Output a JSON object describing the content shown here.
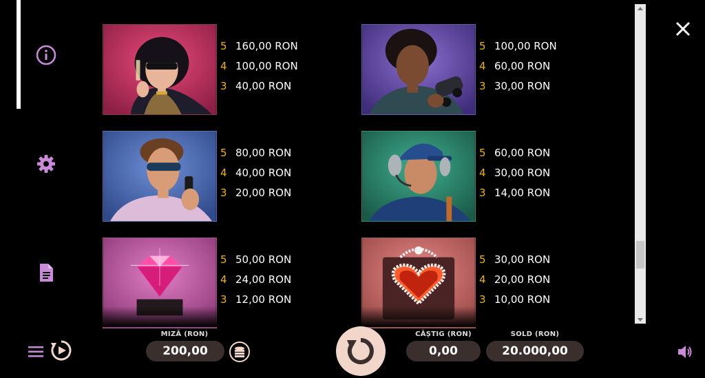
{
  "sidebar": {
    "items": [
      {
        "name": "info",
        "icon": "info-icon"
      },
      {
        "name": "settings",
        "icon": "gear-icon"
      },
      {
        "name": "rules",
        "icon": "document-icon"
      }
    ]
  },
  "paytable": {
    "symbols": [
      {
        "name": "woman-with-sunglasses",
        "payouts": [
          {
            "count": "5",
            "value": "160,00 RON"
          },
          {
            "count": "4",
            "value": "100,00 RON"
          },
          {
            "count": "3",
            "value": "40,00 RON"
          }
        ]
      },
      {
        "name": "man-with-binoculars",
        "payouts": [
          {
            "count": "5",
            "value": "100,00 RON"
          },
          {
            "count": "4",
            "value": "60,00 RON"
          },
          {
            "count": "3",
            "value": "30,00 RON"
          }
        ]
      },
      {
        "name": "man-with-phone",
        "payouts": [
          {
            "count": "5",
            "value": "80,00 RON"
          },
          {
            "count": "4",
            "value": "40,00 RON"
          },
          {
            "count": "3",
            "value": "20,00 RON"
          }
        ]
      },
      {
        "name": "man-with-headset",
        "payouts": [
          {
            "count": "5",
            "value": "60,00 RON"
          },
          {
            "count": "4",
            "value": "30,00 RON"
          },
          {
            "count": "3",
            "value": "14,00 RON"
          }
        ]
      },
      {
        "name": "pink-diamond",
        "payouts": [
          {
            "count": "5",
            "value": "50,00 RON"
          },
          {
            "count": "4",
            "value": "24,00 RON"
          },
          {
            "count": "3",
            "value": "12,00 RON"
          }
        ]
      },
      {
        "name": "heart-jewel",
        "payouts": [
          {
            "count": "5",
            "value": "30,00 RON"
          },
          {
            "count": "4",
            "value": "20,00 RON"
          },
          {
            "count": "3",
            "value": "10,00 RON"
          }
        ]
      }
    ]
  },
  "bottom": {
    "bet_label": "MIZĂ (RON)",
    "bet_value": "200,00",
    "win_label": "CÂȘTIG (RON)",
    "win_value": "0,00",
    "balance_label": "SOLD (RON)",
    "balance_value": "20.000,00"
  },
  "colors": {
    "accent": "#c98ad8",
    "payout_count": "#f0b400",
    "pill": "#3a2f2c",
    "spin": "#f2d6c9"
  }
}
